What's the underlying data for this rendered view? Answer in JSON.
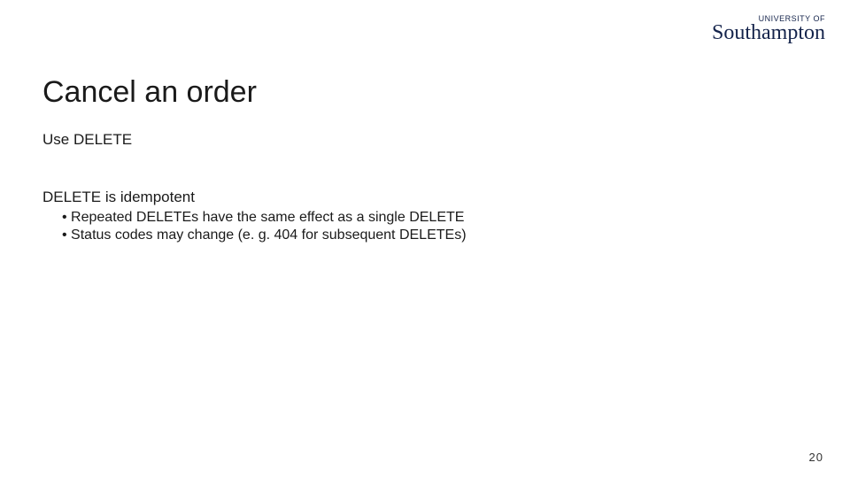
{
  "logo": {
    "overline": "UNIVERSITY OF",
    "main": "Southampton"
  },
  "title": "Cancel an order",
  "line1": "Use DELETE",
  "line2": "DELETE is idempotent",
  "bullets": [
    "Repeated DELETEs have the same effect as a single DELETE",
    "Status codes may change (e. g. 404 for subsequent DELETEs)"
  ],
  "page_number": "20"
}
